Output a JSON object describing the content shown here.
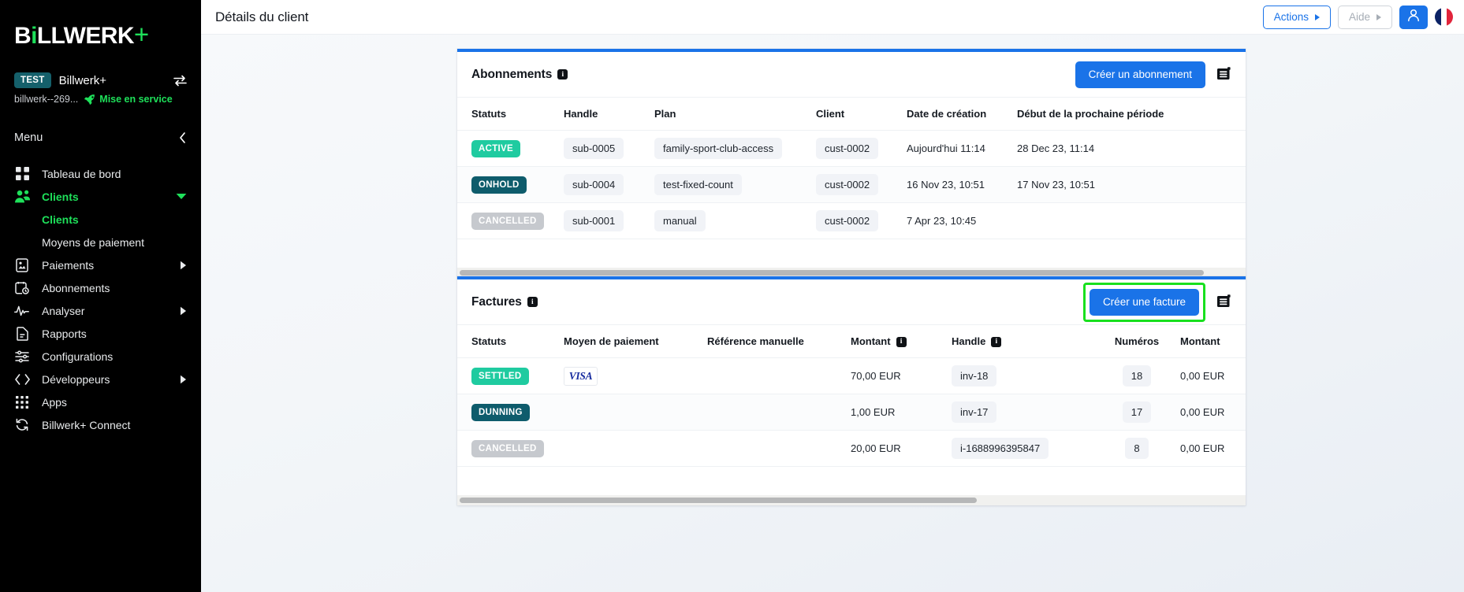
{
  "brand": {
    "logo_main": "BiLLWERK",
    "logo_plus": "+",
    "accent_green": "#1ee05a",
    "accent_blue": "#1a73e8"
  },
  "sidebar": {
    "account": {
      "env_badge": "TEST",
      "name": "Billwerk+",
      "id": "billwerk--269...",
      "status": "Mise en service",
      "swap_icon": "swap-horizontal-icon",
      "rocket_icon": "rocket-icon"
    },
    "menu_label": "Menu",
    "collapse_icon": "chevron-left-icon",
    "items": [
      {
        "label": "Tableau de bord",
        "icon": "dashboard-grid-icon",
        "active": false,
        "expandable": false,
        "children": []
      },
      {
        "label": "Clients",
        "icon": "users-icon",
        "active": true,
        "expandable": true,
        "expanded": true,
        "children": [
          {
            "label": "Clients",
            "active": true
          },
          {
            "label": "Moyens de paiement",
            "active": false
          }
        ]
      },
      {
        "label": "Paiements",
        "icon": "payment-document-icon",
        "active": false,
        "expandable": true,
        "expanded": false,
        "children": []
      },
      {
        "label": "Abonnements",
        "icon": "calendar-clock-icon",
        "active": false,
        "expandable": false,
        "children": []
      },
      {
        "label": "Analyser",
        "icon": "pulse-chart-icon",
        "active": false,
        "expandable": true,
        "expanded": false,
        "children": []
      },
      {
        "label": "Rapports",
        "icon": "report-document-icon",
        "active": false,
        "expandable": false,
        "children": []
      },
      {
        "label": "Configurations",
        "icon": "sliders-icon",
        "active": false,
        "expandable": false,
        "children": []
      },
      {
        "label": "Développeurs",
        "icon": "code-brackets-icon",
        "active": false,
        "expandable": true,
        "expanded": false,
        "children": []
      },
      {
        "label": "Apps",
        "icon": "apps-dots-icon",
        "active": false,
        "expandable": false,
        "children": []
      },
      {
        "label": "Billwerk+ Connect",
        "icon": "sync-refresh-icon",
        "active": false,
        "expandable": false,
        "children": []
      }
    ]
  },
  "topbar": {
    "title": "Détails du client",
    "actions_label": "Actions",
    "aide_label": "Aide",
    "user_icon": "user-avatar-icon",
    "flag": "flag-france-icon"
  },
  "subscriptions_card": {
    "title": "Abonnements",
    "info_icon": "info-icon",
    "create_label": "Créer un abonnement",
    "doc_icon": "invoice-document-icon",
    "columns": [
      "Statuts",
      "Handle",
      "Plan",
      "Client",
      "Date de création",
      "Début de la prochaine période"
    ],
    "rows": [
      {
        "status": "ACTIVE",
        "status_class": "b-active",
        "handle": "sub-0005",
        "plan": "family-sport-club-access",
        "client": "cust-0002",
        "created": "Aujourd'hui 11:14",
        "next_period": "28 Dec 23, 11:14"
      },
      {
        "status": "ONHOLD",
        "status_class": "b-onhold",
        "handle": "sub-0004",
        "plan": "test-fixed-count",
        "client": "cust-0002",
        "created": "16 Nov 23, 10:51",
        "next_period": "17 Nov 23, 10:51"
      },
      {
        "status": "CANCELLED",
        "status_class": "b-cancelled",
        "handle": "sub-0001",
        "plan": "manual",
        "client": "cust-0002",
        "created": "7 Apr 23, 10:45",
        "next_period": ""
      }
    ],
    "scroll_percent": 95
  },
  "invoices_card": {
    "title": "Factures",
    "info_icon": "info-icon",
    "create_label": "Créer une facture",
    "create_highlighted": true,
    "doc_icon": "invoice-document-icon",
    "columns": [
      "Statuts",
      "Moyen de paiement",
      "Référence manuelle",
      "Montant",
      "Handle",
      "Numéros",
      "Montant"
    ],
    "column_info_flags": [
      false,
      false,
      false,
      true,
      true,
      false,
      false
    ],
    "rows": [
      {
        "status": "SETTLED",
        "status_class": "b-settled",
        "method": "VISA",
        "manual_ref": "",
        "amount": "70,00 EUR",
        "handle": "inv-18",
        "number": "18",
        "amount2": "0,00 EUR"
      },
      {
        "status": "DUNNING",
        "status_class": "b-dunning",
        "method": "",
        "manual_ref": "",
        "amount": "1,00 EUR",
        "handle": "inv-17",
        "number": "17",
        "amount2": "0,00 EUR"
      },
      {
        "status": "CANCELLED",
        "status_class": "b-cancelled",
        "method": "",
        "manual_ref": "",
        "amount": "20,00 EUR",
        "handle": "i-1688996395847",
        "number": "8",
        "amount2": "0,00 EUR"
      }
    ],
    "scroll_percent": 66
  }
}
